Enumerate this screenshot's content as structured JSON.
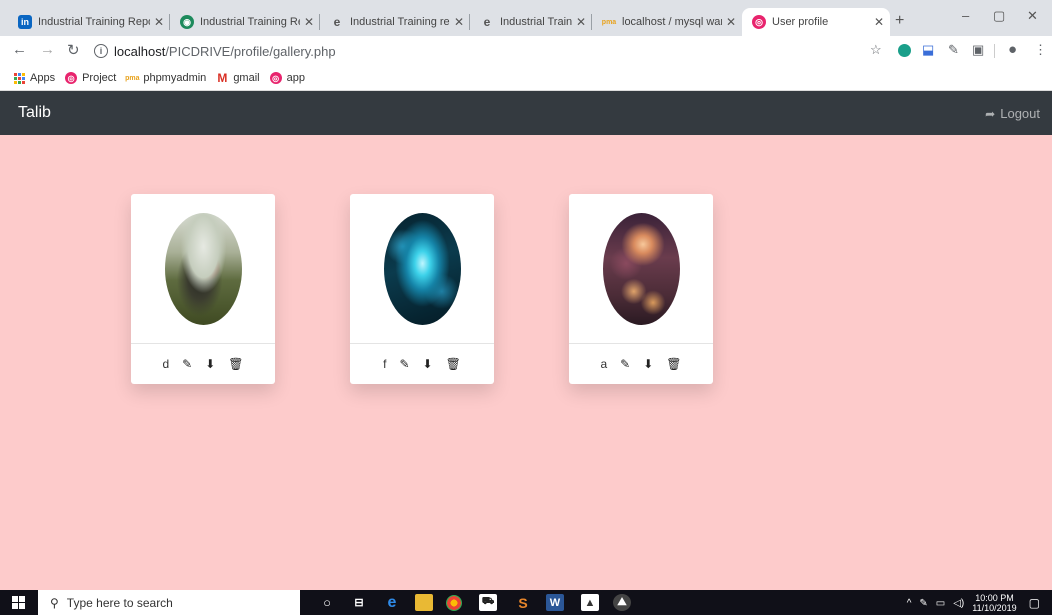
{
  "browser": {
    "tabs": [
      {
        "title": "Industrial Training Repo",
        "icon": "linkedin-icon",
        "color": "#0a66c2",
        "glyph": "in"
      },
      {
        "title": "Industrial Training Repo",
        "icon": "globe-icon",
        "color": "#1d8a5c",
        "glyph": "◉"
      },
      {
        "title": "Industrial Training repo",
        "icon": "edge-doc-icon",
        "color": "#888888",
        "glyph": "e"
      },
      {
        "title": "Industrial Training repo",
        "icon": "edge-doc-icon",
        "color": "#888888",
        "glyph": "e"
      },
      {
        "title": "localhost / mysql wamp",
        "icon": "phpmyadmin-icon",
        "color": "#e8a21c",
        "glyph": "pma"
      },
      {
        "title": "User profile",
        "icon": "app-icon",
        "color": "#e8246d",
        "glyph": "◎",
        "active": true
      }
    ],
    "new_tab": "+",
    "window_controls": [
      "–",
      "▢",
      "✕"
    ],
    "url": {
      "host": "localhost",
      "path": "/PICDRIVE/profile/gallery.php"
    },
    "bookmarks": [
      {
        "label": "Apps",
        "icon": "apps-grid-icon",
        "color": "#4285f4"
      },
      {
        "label": "Project",
        "icon": "app-icon",
        "color": "#e8246d"
      },
      {
        "label": "phpmyadmin",
        "icon": "phpmyadmin-icon",
        "color": "#e8a21c"
      },
      {
        "label": "gmail",
        "icon": "gmail-icon",
        "color": "#d93025"
      },
      {
        "label": "app",
        "icon": "app-icon",
        "color": "#e8246d"
      }
    ]
  },
  "navbar": {
    "brand": "Talib",
    "logout_label": "Logout",
    "bg": "#343a40"
  },
  "page": {
    "bg": "#fdcbcb"
  },
  "gallery": [
    {
      "name": "d",
      "thumb": "motorcycle-photo"
    },
    {
      "name": "f",
      "thumb": "blue-flower-photo"
    },
    {
      "name": "a",
      "thumb": "bokeh-photo"
    }
  ],
  "taskbar": {
    "search_placeholder": "Type here to search",
    "time": "10:00 PM",
    "date": "11/10/2019"
  }
}
